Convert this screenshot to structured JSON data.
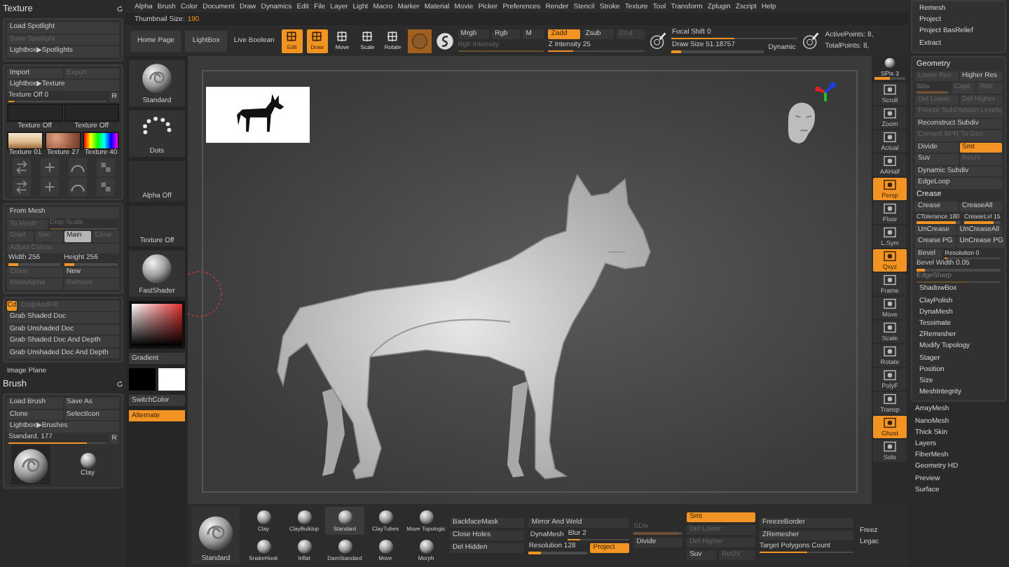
{
  "menu": [
    "Alpha",
    "Brush",
    "Color",
    "Document",
    "Draw",
    "Dynamics",
    "Edit",
    "File",
    "Layer",
    "Light",
    "Macro",
    "Marker",
    "Material",
    "Movie",
    "Picker",
    "Preferences",
    "Render",
    "Stencil",
    "Stroke",
    "Texture",
    "Tool",
    "Transform",
    "Zplugin",
    "Zscript",
    "Help"
  ],
  "thumbnail_size": {
    "label": "Thumbnail Size:",
    "value": "190"
  },
  "toolbar": [
    {
      "kind": "button",
      "label": "Home Page"
    },
    {
      "kind": "button",
      "label": "LightBox"
    },
    {
      "kind": "text",
      "label": "Live Boolean"
    },
    {
      "kind": "tool",
      "label": "Edit",
      "selected": true
    },
    {
      "kind": "tool",
      "label": "Draw",
      "selected": true
    },
    {
      "kind": "tool",
      "label": "Move",
      "selected": false
    },
    {
      "kind": "tool",
      "label": "Scale",
      "selected": false
    },
    {
      "kind": "tool",
      "label": "Rotate",
      "selected": false
    },
    {
      "kind": "material"
    },
    {
      "kind": "stroke-icon"
    },
    {
      "kind": "stack",
      "rows": [
        [
          {
            "kind": "toggle",
            "label": "Mrgb",
            "selected": false,
            "disabled": false
          },
          {
            "kind": "toggle",
            "label": "Rgb",
            "selected": false,
            "disabled": false
          },
          {
            "kind": "toggle",
            "label": "M",
            "selected": false,
            "disabled": false
          }
        ],
        [
          {
            "kind": "slider",
            "label": "Rgb Intensity",
            "level": 1,
            "disabled": true
          }
        ]
      ]
    },
    {
      "kind": "stack",
      "rows": [
        [
          {
            "kind": "toggle",
            "label": "Zadd",
            "selected": true,
            "disabled": false
          },
          {
            "kind": "toggle",
            "label": "Zsub",
            "selected": false,
            "disabled": false
          },
          {
            "kind": "toggle",
            "label": "Zcut",
            "selected": false,
            "disabled": true
          }
        ],
        [
          {
            "kind": "slider",
            "label": "Z Intensity 25",
            "level": 0.25,
            "disabled": false
          }
        ]
      ]
    },
    {
      "kind": "brush-icon"
    },
    {
      "kind": "stack",
      "rows": [
        [
          {
            "kind": "slider",
            "label": "Focal Shift 0",
            "level": 0.5,
            "disabled": false
          }
        ],
        [
          {
            "kind": "slider",
            "label": "Draw Size 51.18757",
            "level": 0.1,
            "disabled": false
          },
          {
            "kind": "text",
            "label": "Dynamic"
          }
        ]
      ]
    },
    {
      "kind": "brush-icon"
    },
    {
      "kind": "stack",
      "rows": [
        [
          {
            "kind": "text",
            "label": "ActivePoints: 8,"
          }
        ],
        [
          {
            "kind": "text",
            "label": "TotalPoints: 8,"
          }
        ]
      ]
    }
  ],
  "side_panels": [
    {
      "sections": [
        {
          "kind": "plain",
          "rows": [
            [
              {
                "kind": "title",
                "label": "Texture"
              }
            ]
          ]
        },
        {
          "kind": "box",
          "rows": [
            [
              {
                "kind": "button",
                "label": "Load Spotlight",
                "selected": false,
                "disabled": false
              }
            ],
            [
              {
                "kind": "button",
                "label": "Save Spotlight",
                "selected": false,
                "disabled": true
              }
            ],
            [
              {
                "kind": "button",
                "label": "Lightbox▶Spotlights",
                "selected": false,
                "disabled": false
              }
            ]
          ]
        },
        {
          "kind": "box",
          "rows": [
            [
              {
                "kind": "button",
                "label": "Import",
                "selected": false,
                "disabled": false
              },
              {
                "kind": "button",
                "label": "Export",
                "selected": false,
                "disabled": true
              }
            ],
            [
              {
                "kind": "button",
                "label": "Lightbox▶Texture",
                "selected": false,
                "disabled": false
              }
            ],
            [
              {
                "kind": "slider-reset",
                "label": "Texture Off  0",
                "level": 0.05,
                "reset_label": "R"
              }
            ],
            [
              {
                "kind": "texture-blank",
                "label": "Texture Off"
              },
              {
                "kind": "texture-blank",
                "label": "Texture Off"
              }
            ],
            [
              {
                "kind": "texture-room",
                "label": "Texture 01"
              },
              {
                "kind": "texture-noise",
                "label": "Texture 27"
              },
              {
                "kind": "texture-spectrum",
                "label": "Texture 40"
              }
            ],
            [
              {
                "kind": "icon-row"
              }
            ],
            [
              {
                "kind": "icon-row"
              }
            ]
          ]
        },
        {
          "kind": "box",
          "rows": [
            [
              {
                "kind": "button",
                "label": "From Mesh",
                "selected": false,
                "disabled": false
              }
            ],
            [
              {
                "kind": "button",
                "label": "To Mesh",
                "selected": false,
                "disabled": true
              },
              {
                "kind": "slider",
                "label": "Disp Scale",
                "level": 0.2,
                "disabled": true
              }
            ],
            [
              {
                "kind": "toggle",
                "label": "Grad",
                "selected": false,
                "disabled": true
              },
              {
                "kind": "toggle",
                "label": "Sec",
                "selected": false,
                "disabled": true
              },
              {
                "kind": "toggle",
                "label": "Main",
                "selected": true,
                "disabled": false
              },
              {
                "kind": "toggle",
                "label": "Clear",
                "selected": false,
                "disabled": true
              }
            ],
            [
              {
                "kind": "button",
                "label": "Adjust Colors",
                "selected": false,
                "disabled": true
              }
            ],
            [
              {
                "kind": "slider",
                "label": "Width 256",
                "level": 0.2,
                "disabled": false
              },
              {
                "kind": "slider",
                "label": "Height 256",
                "level": 0.2,
                "disabled": false
              }
            ],
            [
              {
                "kind": "button",
                "label": "Clone",
                "selected": false,
                "disabled": true
              },
              {
                "kind": "button",
                "label": "New",
                "selected": false,
                "disabled": false
              }
            ],
            [
              {
                "kind": "button",
                "label": "MakeAlpha",
                "selected": false,
                "disabled": true
              },
              {
                "kind": "button",
                "label": "Remove",
                "selected": false,
                "disabled": true
              }
            ]
          ]
        },
        {
          "kind": "box",
          "rows": [
            [
              {
                "kind": "button",
                "label": "Cd",
                "selected": true,
                "disabled": false
              },
              {
                "kind": "button",
                "label": "CropAndFill",
                "selected": false,
                "disabled": true
              }
            ],
            [
              {
                "kind": "button",
                "label": "Grab Shaded Doc",
                "selected": false,
                "disabled": false
              }
            ],
            [
              {
                "kind": "button",
                "label": "Grab Unshaded Doc",
                "selected": false,
                "disabled": false
              }
            ],
            [
              {
                "kind": "button",
                "label": "Grab Shaded Doc And Depth",
                "selected": false,
                "disabled": false
              }
            ],
            [
              {
                "kind": "button",
                "label": "Grab Unshaded Doc And Depth",
                "selected": false,
                "disabled": false
              }
            ]
          ]
        },
        {
          "kind": "plain",
          "rows": [
            [
              {
                "kind": "text",
                "label": "Image Plane"
              }
            ],
            [
              {
                "kind": "title",
                "label": "Brush"
              }
            ]
          ]
        },
        {
          "kind": "box",
          "rows": [
            [
              {
                "kind": "button",
                "label": "Load Brush",
                "selected": false,
                "disabled": false
              },
              {
                "kind": "button",
                "label": "Save As",
                "selected": false,
                "disabled": false
              }
            ],
            [
              {
                "kind": "button",
                "label": "Clone",
                "selected": false,
                "disabled": false
              },
              {
                "kind": "button",
                "label": "SelectIcon",
                "selected": false,
                "disabled": false
              }
            ],
            [
              {
                "kind": "button",
                "label": "Lightbox▶Brushes",
                "selected": false,
                "disabled": false
              }
            ],
            [
              {
                "kind": "slider-reset",
                "label": "Standard.  177",
                "level": 0.8,
                "reset_label": "R"
              }
            ],
            [
              {
                "kind": "brush-preview"
              },
              {
                "kind": "brush",
                "label": "Clay"
              }
            ]
          ]
        }
      ]
    },
    {
      "sections": [
        {
          "kind": "box",
          "rows": [
            [
              {
                "kind": "item",
                "label": "Remesh"
              }
            ],
            [
              {
                "kind": "item",
                "label": "Project"
              }
            ],
            [
              {
                "kind": "item",
                "label": "Project BasRelief"
              }
            ],
            [
              {
                "kind": "item",
                "label": "Extract"
              }
            ]
          ]
        },
        {
          "kind": "box",
          "rows": [
            [
              {
                "kind": "heading",
                "label": "Geometry"
              }
            ],
            [
              {
                "kind": "button",
                "label": "Lower Res",
                "selected": false,
                "disabled": true
              },
              {
                "kind": "button",
                "label": "Higher Res",
                "selected": false,
                "disabled": false
              }
            ],
            [
              {
                "kind": "slider",
                "label": "SDiv",
                "level": 0.9,
                "disabled": true
              },
              {
                "kind": "button",
                "label": "Cage",
                "selected": false,
                "disabled": true
              },
              {
                "kind": "button",
                "label": "Rstr",
                "selected": false,
                "disabled": true
              }
            ],
            [
              {
                "kind": "button",
                "label": "Del Lower",
                "selected": false,
                "disabled": true
              },
              {
                "kind": "button",
                "label": "Del Higher",
                "selected": false,
                "disabled": true
              }
            ],
            [
              {
                "kind": "button",
                "label": "Freeze SubDivision Levels",
                "selected": false,
                "disabled": true
              }
            ],
            [
              {
                "kind": "button",
                "label": "Reconstruct Subdiv",
                "selected": false,
                "disabled": false
              }
            ],
            [
              {
                "kind": "button",
                "label": "Convert BPR To Geo",
                "selected": false,
                "disabled": true
              }
            ],
            [
              {
                "kind": "button",
                "label": "Divide",
                "selected": false,
                "disabled": false
              },
              {
                "kind": "button",
                "label": "Smt",
                "selected": true,
                "disabled": false
              }
            ],
            [
              {
                "kind": "button",
                "label": "Suv",
                "selected": false,
                "disabled": false
              },
              {
                "kind": "button",
                "label": "ReUV",
                "selected": false,
                "disabled": true
              }
            ],
            [
              {
                "kind": "button",
                "label": "Dynamic Subdiv",
                "selected": false,
                "disabled": false
              }
            ],
            [
              {
                "kind": "button",
                "label": "EdgeLoop",
                "selected": false,
                "disabled": false
              }
            ],
            [
              {
                "kind": "heading",
                "label": "Crease"
              }
            ],
            [
              {
                "kind": "button",
                "label": "Crease",
                "selected": false,
                "disabled": false
              },
              {
                "kind": "button",
                "label": "CreaseAll",
                "selected": false,
                "disabled": false
              }
            ],
            [
              {
                "kind": "slider",
                "label": "CTolerance 180",
                "level": 0.9,
                "disabled": false
              },
              {
                "kind": "slider",
                "label": "CreaseLvl 15",
                "level": 0.8,
                "disabled": false
              }
            ],
            [
              {
                "kind": "button",
                "label": "UnCrease",
                "selected": false,
                "disabled": false
              },
              {
                "kind": "button",
                "label": "UnCreaseAll",
                "selected": false,
                "disabled": false
              }
            ],
            [
              {
                "kind": "button",
                "label": "Crease PG",
                "selected": false,
                "disabled": false
              },
              {
                "kind": "button",
                "label": "UnCrease PG",
                "selected": false,
                "disabled": false
              }
            ],
            [
              {
                "kind": "button",
                "label": "Bevel",
                "selected": false,
                "disabled": false
              },
              {
                "kind": "slider",
                "label": "Resolution 0",
                "level": 0.05,
                "disabled": false
              }
            ],
            [
              {
                "kind": "slider",
                "label": "Bevel Width 0.05",
                "level": 0.1,
                "disabled": false
              }
            ],
            [
              {
                "kind": "slider",
                "label": "EdgeSharp",
                "level": 0.6,
                "disabled": true
              }
            ],
            [
              {
                "kind": "item",
                "label": "ShadowBox"
              }
            ],
            [
              {
                "kind": "item",
                "label": "ClayPolish"
              }
            ],
            [
              {
                "kind": "item",
                "label": "DynaMesh"
              }
            ],
            [
              {
                "kind": "item",
                "label": "Tessimate"
              }
            ],
            [
              {
                "kind": "item",
                "label": "ZRemesher"
              }
            ],
            [
              {
                "kind": "item",
                "label": "Modify Topology"
              }
            ],
            [
              {
                "kind": "item",
                "label": "Stager"
              }
            ],
            [
              {
                "kind": "item",
                "label": "Position"
              }
            ],
            [
              {
                "kind": "item",
                "label": "Size"
              }
            ],
            [
              {
                "kind": "item",
                "label": "MeshIntegrity"
              }
            ]
          ]
        },
        {
          "kind": "plain",
          "rows": [
            [
              {
                "kind": "item",
                "label": "ArrayMesh"
              }
            ],
            [
              {
                "kind": "item",
                "label": "NanoMesh"
              }
            ],
            [
              {
                "kind": "item",
                "label": "Thick Skin"
              }
            ],
            [
              {
                "kind": "item",
                "label": "Layers"
              }
            ],
            [
              {
                "kind": "item",
                "label": "FiberMesh"
              }
            ],
            [
              {
                "kind": "item",
                "label": "Geometry HD"
              }
            ],
            [
              {
                "kind": "item",
                "label": "Preview"
              }
            ],
            [
              {
                "kind": "item",
                "label": "Surface"
              }
            ]
          ]
        }
      ]
    }
  ],
  "left_shelf": [
    {
      "kind": "brush",
      "label": "Standard"
    },
    {
      "kind": "stroke",
      "label": "Dots"
    },
    {
      "kind": "slot",
      "label": "Alpha Off"
    },
    {
      "kind": "slot",
      "label": "Texture Off"
    },
    {
      "kind": "material",
      "label": "FastShader"
    },
    {
      "kind": "picker"
    },
    {
      "kind": "button",
      "label": "Gradient",
      "selected": false
    },
    {
      "kind": "swatches"
    },
    {
      "kind": "button",
      "label": "SwitchColor",
      "selected": false
    },
    {
      "kind": "button",
      "label": "Alternate",
      "selected": true
    }
  ],
  "right_shelf": [
    {
      "kind": "slider",
      "label": "SPix 3",
      "level": 0.5
    },
    {
      "kind": "button",
      "label": "Scroll",
      "selected": false
    },
    {
      "kind": "button",
      "label": "Zoom",
      "selected": false
    },
    {
      "kind": "button",
      "label": "Actual",
      "selected": false
    },
    {
      "kind": "button",
      "label": "AAHalf",
      "selected": false
    },
    {
      "kind": "button",
      "label": "Persp",
      "selected": true
    },
    {
      "kind": "button",
      "label": "Floor",
      "selected": false
    },
    {
      "kind": "button",
      "label": "L.Sym",
      "selected": false
    },
    {
      "kind": "button",
      "label": "Qxyz",
      "selected": true
    },
    {
      "kind": "button",
      "label": "Frame",
      "selected": false
    },
    {
      "kind": "button",
      "label": "Move",
      "selected": false
    },
    {
      "kind": "button",
      "label": "Scale",
      "selected": false
    },
    {
      "kind": "button",
      "label": "Rotate",
      "selected": false
    },
    {
      "kind": "button",
      "label": "PolyF",
      "selected": false
    },
    {
      "kind": "button",
      "label": "Transp",
      "selected": false
    },
    {
      "kind": "button",
      "label": "Ghost",
      "selected": true
    },
    {
      "kind": "button",
      "label": "Solo",
      "selected": false
    }
  ],
  "bottom_bar": [
    {
      "kind": "current-brush",
      "label": "Standard"
    },
    {
      "kind": "brushes",
      "items": [
        {
          "label": "Clay",
          "selected": false
        },
        {
          "label": "ClayBuildup",
          "selected": false
        },
        {
          "label": "Standard",
          "selected": true
        },
        {
          "label": "ClayTubes",
          "selected": false
        },
        {
          "label": "Move Topologic",
          "selected": false
        },
        {
          "label": "SnakeHook",
          "selected": false
        },
        {
          "label": "Inflat",
          "selected": false
        },
        {
          "label": "DamStandard",
          "selected": false
        },
        {
          "label": "Move",
          "selected": false
        },
        {
          "label": "Morph",
          "selected": false
        }
      ]
    },
    {
      "kind": "stack",
      "rows": [
        [
          {
            "kind": "toggle",
            "label": "BackfaceMask",
            "selected": false,
            "disabled": false
          }
        ],
        [
          {
            "kind": "toggle",
            "label": "Close Holes",
            "selected": false,
            "disabled": false
          }
        ],
        [
          {
            "kind": "toggle",
            "label": "Del Hidden",
            "selected": false,
            "disabled": false
          }
        ]
      ]
    },
    {
      "kind": "stack",
      "rows": [
        [
          {
            "kind": "toggle",
            "label": "Mirror And Weld",
            "selected": false,
            "disabled": false
          }
        ],
        [
          {
            "kind": "text",
            "label": "DynaMesh"
          },
          {
            "kind": "slider",
            "label": "Blur 2",
            "level": 0.2,
            "disabled": false
          }
        ],
        [
          {
            "kind": "slider",
            "label": "Resolution 128",
            "level": 0.2,
            "disabled": false
          },
          {
            "kind": "toggle",
            "label": "Project",
            "selected": true,
            "disabled": false
          }
        ]
      ]
    },
    {
      "kind": "stack",
      "rows": [
        [
          {
            "kind": "slider",
            "label": "SDiv",
            "level": 0.9,
            "disabled": true
          }
        ],
        [
          {
            "kind": "toggle",
            "label": "Divide",
            "selected": false,
            "disabled": false
          }
        ]
      ]
    },
    {
      "kind": "stack",
      "rows": [
        [
          {
            "kind": "toggle",
            "label": "Smt",
            "selected": true,
            "disabled": false
          }
        ],
        [
          {
            "kind": "toggle",
            "label": "Del Lower",
            "selected": false,
            "disabled": true
          }
        ],
        [
          {
            "kind": "toggle",
            "label": "Del Higher",
            "selected": false,
            "disabled": true
          }
        ],
        [
          {
            "kind": "toggle",
            "label": "Suv",
            "selected": false,
            "disabled": false
          },
          {
            "kind": "toggle",
            "label": "ReUV",
            "selected": false,
            "disabled": true
          }
        ]
      ]
    },
    {
      "kind": "stack",
      "rows": [
        [
          {
            "kind": "toggle",
            "label": "FreezeBorder",
            "selected": false,
            "disabled": false
          }
        ],
        [
          {
            "kind": "toggle",
            "label": "ZRemesher",
            "selected": false,
            "disabled": false
          }
        ],
        [
          {
            "kind": "slider",
            "label": "Target Polygons Count",
            "level": 0.5,
            "disabled": false
          }
        ]
      ]
    },
    {
      "kind": "stack",
      "rows": [
        [
          {
            "kind": "text",
            "label": "Freez"
          }
        ],
        [
          {
            "kind": "text",
            "label": "Legac"
          }
        ]
      ]
    }
  ]
}
